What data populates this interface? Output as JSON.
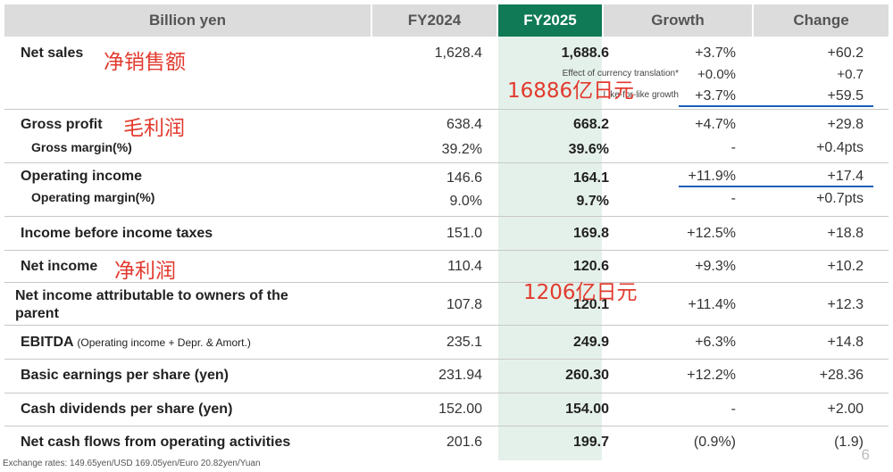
{
  "header": {
    "label_col": "Billion yen",
    "fy2024": "FY2024",
    "fy2025": "FY2025",
    "growth": "Growth",
    "change": "Change"
  },
  "rows": {
    "net_sales": {
      "label": "Net sales",
      "fy2024": "1,628.4",
      "fy2025": "1,688.6",
      "growth": "+3.7%",
      "change": "+60.2"
    },
    "currency_translation": {
      "label": "Effect of currency translation*",
      "growth": "+0.0%",
      "change": "+0.7"
    },
    "like_for_like": {
      "label": "Like-for-like growth",
      "growth": "+3.7%",
      "change": "+59.5"
    },
    "gross_profit": {
      "label": "Gross profit",
      "fy2024": "638.4",
      "fy2025": "668.2",
      "growth": "+4.7%",
      "change": "+29.8"
    },
    "gross_margin": {
      "label": "Gross margin(%)",
      "fy2024": "39.2%",
      "fy2025": "39.6%",
      "growth": "-",
      "change": "+0.4pts"
    },
    "operating_income": {
      "label": "Operating income",
      "fy2024": "146.6",
      "fy2025": "164.1",
      "growth": "+11.9%",
      "change": "+17.4"
    },
    "operating_margin": {
      "label": "Operating margin(%)",
      "fy2024": "9.0%",
      "fy2025": "9.7%",
      "growth": "-",
      "change": "+0.7pts"
    },
    "income_before_taxes": {
      "label": "Income before income taxes",
      "fy2024": "151.0",
      "fy2025": "169.8",
      "growth": "+12.5%",
      "change": "+18.8"
    },
    "net_income": {
      "label": "Net income",
      "fy2024": "110.4",
      "fy2025": "120.6",
      "growth": "+9.3%",
      "change": "+10.2"
    },
    "net_income_owners": {
      "label": "Net income attributable to owners of the parent",
      "fy2024": "107.8",
      "fy2025": "120.1",
      "growth": "+11.4%",
      "change": "+12.3"
    },
    "ebitda": {
      "label": "EBITDA",
      "label_note": "(Operating income + Depr. & Amort.)",
      "fy2024": "235.1",
      "fy2025": "249.9",
      "growth": "+6.3%",
      "change": "+14.8"
    },
    "basic_eps": {
      "label": "Basic earnings per share (yen)",
      "fy2024": "231.94",
      "fy2025": "260.30",
      "growth": "+12.2%",
      "change": "+28.36"
    },
    "cash_dividends": {
      "label": "Cash dividends per share (yen)",
      "fy2024": "152.00",
      "fy2025": "154.00",
      "growth": "-",
      "change": "+2.00"
    },
    "operating_cash_flows": {
      "label": "Net cash flows from operating activities",
      "fy2024": "201.6",
      "fy2025": "199.7",
      "growth": "(0.9%)",
      "change": "(1.9)"
    }
  },
  "annotations": {
    "net_sales_cn": "净销售额",
    "sales_amount_cn": "16886亿日元",
    "gross_profit_cn": "毛利润",
    "net_income_cn": "净利润",
    "net_income_amount_cn": "1206亿日元"
  },
  "footer": {
    "exchange_rates": "Exchange rates: 149.65yen/USD 169.05yen/Euro 20.82yen/Yuan",
    "page_number": "6"
  },
  "colors": {
    "accent_header": "#0f7a55",
    "highlight_column": "#e4f1ea",
    "annotation_red": "#e23a2e",
    "underline_blue": "#1a5eb8"
  }
}
